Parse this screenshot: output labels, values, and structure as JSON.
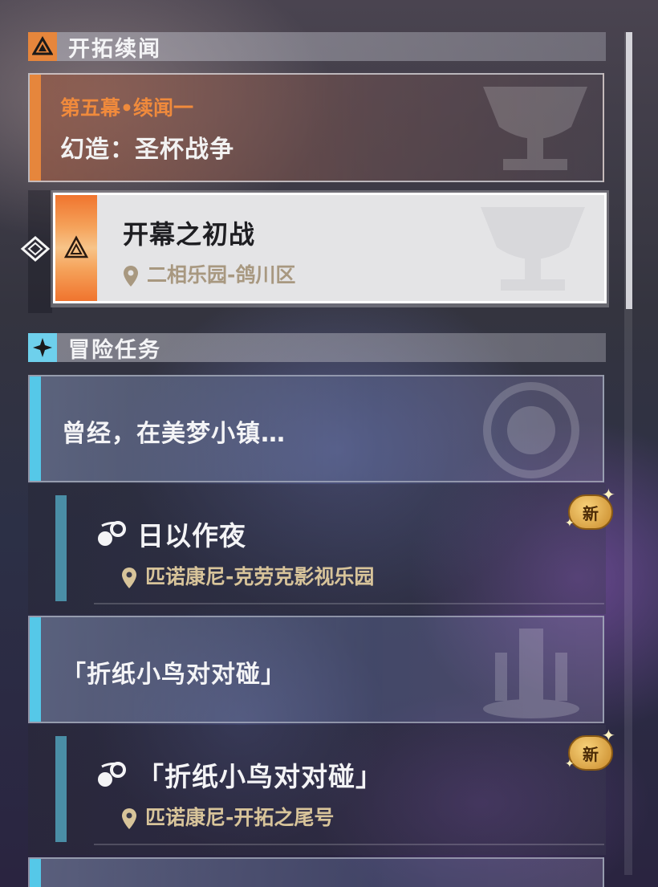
{
  "trailblaze": {
    "section_title": "开拓续闻",
    "chapter": {
      "subtitle": "第五幕•续闻一",
      "title": "幻造：圣杯战争"
    },
    "selected_quest": {
      "title": "开幕之初战",
      "location": "二相乐园-鸽川区"
    }
  },
  "adventure": {
    "section_title": "冒险任务",
    "groups": [
      {
        "title": "曾经，在美梦小镇…",
        "quest": {
          "title": "日以作夜",
          "location": "匹诺康尼-克劳克影视乐园",
          "badge": "新"
        }
      },
      {
        "title": "「折纸小鸟对对碰」",
        "quest": {
          "title": "「折纸小鸟对对碰」",
          "location": "匹诺康尼-开拓之尾号",
          "badge": "新"
        }
      }
    ]
  },
  "colors": {
    "trailblaze_accent": "#e6863c",
    "adventure_accent": "#55c8e8",
    "location_text": "#d8c49a"
  },
  "icons": [
    "trailblaze-icon",
    "adventure-icon",
    "selection-cursor-icon",
    "location-pin-icon",
    "quest-type-icon",
    "new-badge-icon"
  ]
}
